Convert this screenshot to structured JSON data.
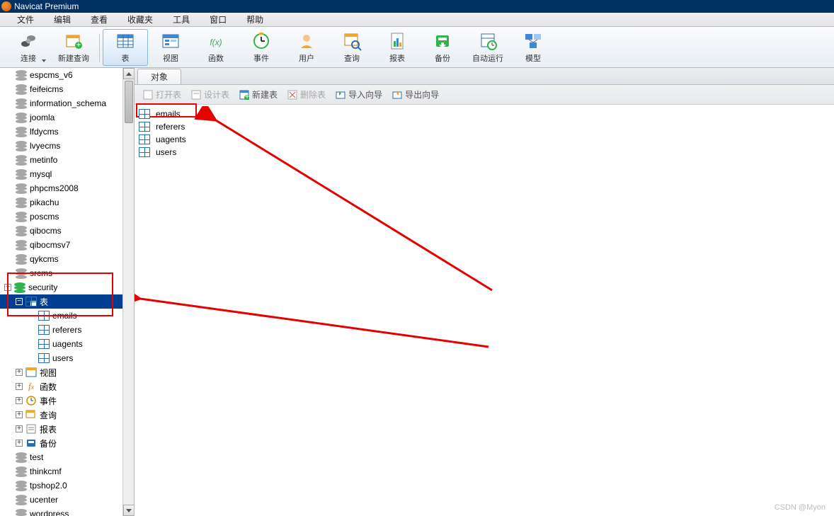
{
  "title": "Navicat Premium",
  "menu": [
    "文件",
    "编辑",
    "查看",
    "收藏夹",
    "工具",
    "窗口",
    "帮助"
  ],
  "toolbar": [
    {
      "id": "connect",
      "label": "连接",
      "drop": true
    },
    {
      "id": "newquery",
      "label": "新建查询"
    },
    {
      "id": "sep"
    },
    {
      "id": "table",
      "label": "表",
      "selected": true
    },
    {
      "id": "view",
      "label": "视图"
    },
    {
      "id": "func",
      "label": "函数"
    },
    {
      "id": "event",
      "label": "事件"
    },
    {
      "id": "user",
      "label": "用户"
    },
    {
      "id": "query",
      "label": "查询"
    },
    {
      "id": "report",
      "label": "报表"
    },
    {
      "id": "backup",
      "label": "备份"
    },
    {
      "id": "auto",
      "label": "自动运行"
    },
    {
      "id": "model",
      "label": "模型"
    }
  ],
  "tree_dbs_top": [
    "espcms_v6",
    "feifeicms",
    "information_schema",
    "joomla",
    "lfdycms",
    "lvyecms",
    "metinfo",
    "mysql",
    "phpcms2008",
    "pikachu",
    "poscms",
    "qibocms",
    "qibocmsv7",
    "qykcms",
    "srcms"
  ],
  "security_db": "security",
  "tables_node": "表",
  "security_tables": [
    "emails",
    "referers",
    "uagents",
    "users"
  ],
  "security_children": [
    {
      "label": "视图",
      "icon": "view"
    },
    {
      "label": "函数",
      "icon": "fx"
    },
    {
      "label": "事件",
      "icon": "clock"
    },
    {
      "label": "查询",
      "icon": "query"
    },
    {
      "label": "报表",
      "icon": "report"
    },
    {
      "label": "备份",
      "icon": "backup"
    }
  ],
  "tree_dbs_bottom": [
    "test",
    "thinkcmf",
    "tpshop2.0",
    "ucenter",
    "wordpress"
  ],
  "tab_label": "对象",
  "obj_toolbar": [
    {
      "label": "打开表",
      "disabled": true
    },
    {
      "label": "设计表",
      "disabled": true
    },
    {
      "label": "新建表",
      "disabled": false
    },
    {
      "label": "删除表",
      "disabled": true
    },
    {
      "label": "导入向导",
      "disabled": false
    },
    {
      "label": "导出向导",
      "disabled": false
    }
  ],
  "obj_list": [
    "emails",
    "referers",
    "uagents",
    "users"
  ],
  "watermark": "CSDN @Myon⁣"
}
